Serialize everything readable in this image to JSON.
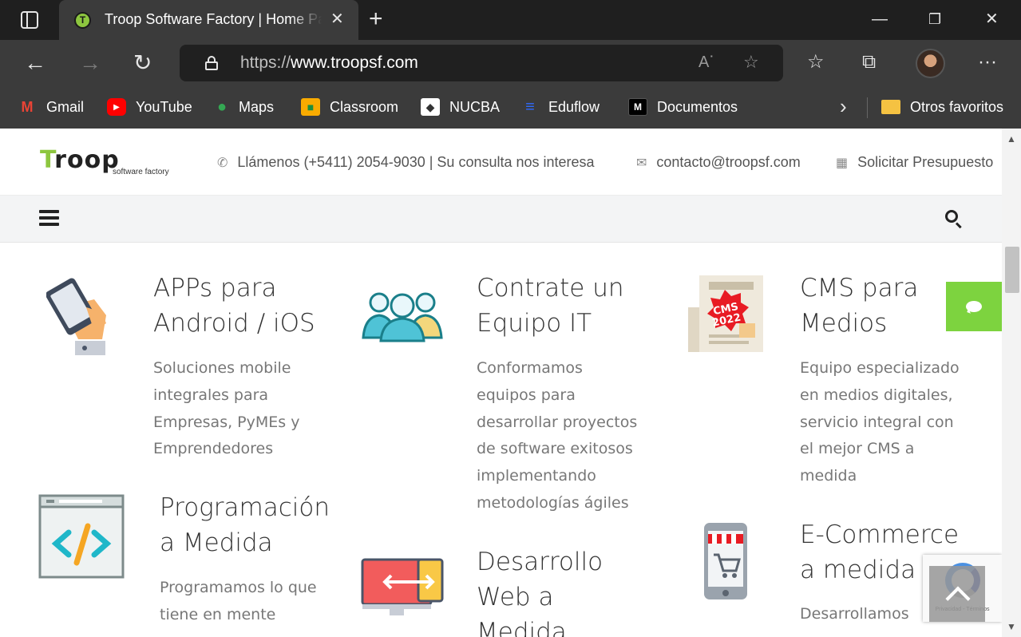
{
  "browser": {
    "tab_title": "Troop Software Factory | Home Page",
    "url_scheme": "https://",
    "url_host": "www.troopsf.com",
    "bookmarks": [
      {
        "label": "Gmail",
        "icon": "gmail-icon",
        "color": "#ea4335"
      },
      {
        "label": "YouTube",
        "icon": "youtube-icon",
        "color": "#ff0000"
      },
      {
        "label": "Maps",
        "icon": "maps-icon",
        "color": "#34a853"
      },
      {
        "label": "Classroom",
        "icon": "classroom-icon",
        "color": "#f9ab00"
      },
      {
        "label": "NUCBA",
        "icon": "nucba-icon",
        "color": "#ffffff"
      },
      {
        "label": "Eduflow",
        "icon": "eduflow-icon",
        "color": "#2f6bff"
      },
      {
        "label": "Documentos",
        "icon": "documentos-icon",
        "color": "#000000"
      }
    ],
    "other_favorites": "Otros favoritos"
  },
  "site": {
    "logo_text": "roop",
    "logo_letter": "T",
    "logo_subtitle": "software factory",
    "phone_text": "Llámenos (+5411) 2054-9030 | Su consulta nos interesa",
    "email_text": "contacto@troopsf.com",
    "quote_text": "Solicitar Presupuesto",
    "accent_color": "#8dc63f"
  },
  "services": [
    {
      "title_1": "APPs para",
      "title_2": "Android / iOS",
      "desc": [
        "Soluciones mobile",
        "integrales para",
        "Empresas, PyMEs y",
        "Emprendedores"
      ],
      "icon": "mobile-app-icon"
    },
    {
      "title_1": "Contrate un",
      "title_2": "Equipo IT",
      "desc": [
        "Conformamos",
        "equipos para",
        "desarrollar proyectos",
        "de software exitosos",
        "implementando",
        "metodologías ágiles"
      ],
      "icon": "team-icon"
    },
    {
      "title_1": "CMS para",
      "title_2": "Medios",
      "desc": [
        "Equipo especializado",
        "en medios digitales,",
        "servicio integral con",
        "el mejor CMS a",
        "medida"
      ],
      "icon": "cms-icon",
      "badge_1": "CMS",
      "badge_2": "2022"
    },
    {
      "title_1": "Programación",
      "title_2": "a Medida",
      "desc": [
        "Programamos lo que",
        "tiene en mente"
      ],
      "icon": "code-icon"
    },
    {
      "title_1": "Desarrollo",
      "title_2": "Web a",
      "title_3": "Medida",
      "icon": "web-dev-icon"
    },
    {
      "title_1": "E-Commerce",
      "title_2": "a medida",
      "desc": [
        "Desarrollamos"
      ],
      "icon": "ecommerce-icon"
    }
  ],
  "recaptcha_text": "Privacidad - Términos"
}
